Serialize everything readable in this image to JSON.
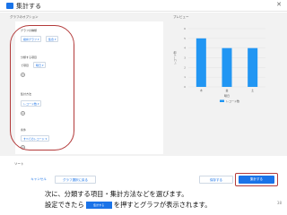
{
  "dialog": {
    "title": "集計する",
    "close_symbol": "✕"
  },
  "headers": {
    "options": "グラフのオプション",
    "preview": "プレビュー"
  },
  "sections": [
    {
      "label": "グラフの種類",
      "chips": [
        "縦棒グラフ ▾",
        "集合 ▾"
      ]
    },
    {
      "label": "分類する項目",
      "plain": "で項目",
      "chips": [
        "曜日 ▾"
      ]
    },
    {
      "label": "集計方法",
      "chips": [
        "レコード数 ▾"
      ]
    },
    {
      "label": "条件",
      "chips": [
        "すべてのレコード ▾"
      ]
    }
  ],
  "chart_data": {
    "type": "bar",
    "categories": [
      "木",
      "金",
      "土"
    ],
    "values": [
      5,
      4,
      4
    ],
    "ylim": [
      0,
      6
    ],
    "y_ticks": [
      "6",
      "5",
      "4",
      "3",
      "2",
      "1",
      "0"
    ],
    "ylabel": "レコード数",
    "xlabel": "曜日",
    "legend": "レコード数",
    "grid": true,
    "color": "#2196f3"
  },
  "footer": {
    "sort_label": "ソート",
    "cancel": "キャンセル",
    "back": "グラフ選択に戻る",
    "save": "保存する",
    "aggregate": "集計する"
  },
  "caption": {
    "line1": "次に、分類する項目・集計方法などを選びます。",
    "line2_before": "設定できたら",
    "inline_button": "集計する",
    "line2_after": "を押すとグラフが表示されます。"
  },
  "page_number": "38"
}
